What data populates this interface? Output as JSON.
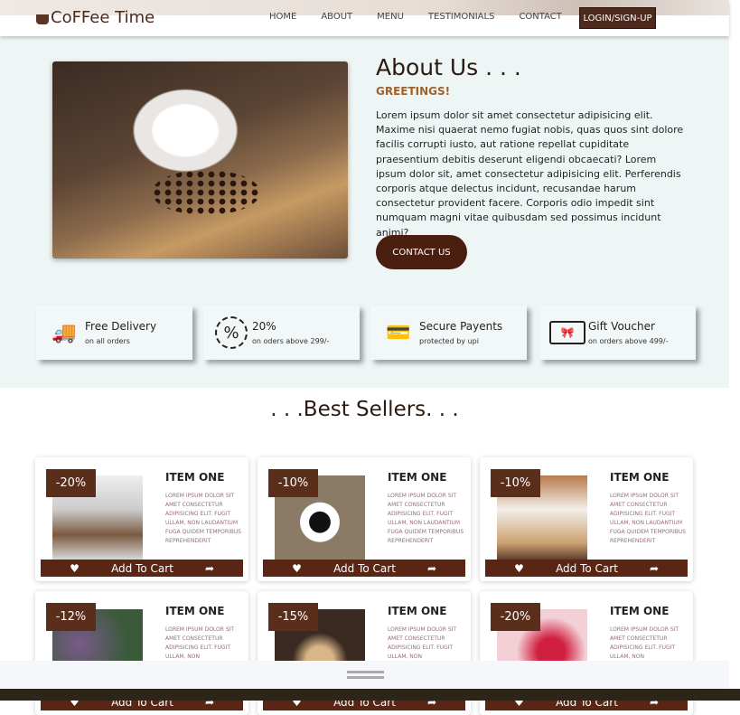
{
  "header": {
    "logo": "CoFFee Time",
    "nav": [
      "HOME",
      "ABOUT",
      "MENU",
      "TESTIMONIALS",
      "CONTACT"
    ],
    "login": "LOGIN/SIGN-UP"
  },
  "about": {
    "title": "About Us . . .",
    "subtitle": "GREETINGS!",
    "text": "Lorem ipsum dolor sit amet consectetur adipisicing elit. Maxime nisi quaerat nemo fugiat nobis, quas quos sint dolore facilis corrupti iusto, aut ratione repellat cupiditate praesentium debitis deserunt eligendi obcaecati? Lorem ipsum dolor sit, amet consectetur adipisicing elit. Perferendis corporis atque delectus incidunt, recusandae harum consectetur provident facere. Corporis odio impedit sint numquam magni vitae quibusdam sed possimus incidunt animi?",
    "button": "CONTACT US"
  },
  "features": [
    {
      "icon": "delivery-truck-icon",
      "title": "Free Delivery",
      "sub": "on all orders"
    },
    {
      "icon": "percent-badge-icon",
      "title": "20%",
      "sub": "on oders above 299/-"
    },
    {
      "icon": "card-payment-icon",
      "title": "Secure Payents",
      "sub": "protected by upi"
    },
    {
      "icon": "gift-voucher-icon",
      "title": "Gift Voucher",
      "sub": "on orders above 499/-"
    }
  ],
  "best_sellers": {
    "title": ". . .Best Sellers. . .",
    "add_to_cart": "Add To Cart",
    "items": [
      {
        "discount": "-20%",
        "name": "ITEM ONE",
        "desc": "LOREM IPSUM DOLOR SIT AMET CONSECTETUR ADIPISICING ELIT. FUGIT ULLAM, NON LAUDANTIUM FUGA QUIDEM TEMPORIBUS REPREHENDERIT"
      },
      {
        "discount": "-10%",
        "name": "ITEM ONE",
        "desc": "LOREM IPSUM DOLOR SIT AMET CONSECTETUR ADIPISICING ELIT. FUGIT ULLAM, NON LAUDANTIUM FUGA QUIDEM TEMPORIBUS REPREHENDERIT"
      },
      {
        "discount": "-10%",
        "name": "ITEM ONE",
        "desc": "LOREM IPSUM DOLOR SIT AMET CONSECTETUR ADIPISICING ELIT. FUGIT ULLAM, NON LAUDANTIUM FUGA QUIDEM TEMPORIBUS REPREHENDERIT"
      },
      {
        "discount": "-12%",
        "name": "ITEM ONE",
        "desc": "LOREM IPSUM DOLOR SIT AMET CONSECTETUR ADIPISICING ELIT. FUGIT ULLAM, NON"
      },
      {
        "discount": "-15%",
        "name": "ITEM ONE",
        "desc": "LOREM IPSUM DOLOR SIT AMET CONSECTETUR ADIPISICING ELIT. FUGIT ULLAM, NON"
      },
      {
        "discount": "-20%",
        "name": "ITEM ONE",
        "desc": "LOREM IPSUM DOLOR SIT AMET CONSECTETUR ADIPISICING ELIT. FUGIT ULLAM, NON"
      }
    ]
  }
}
